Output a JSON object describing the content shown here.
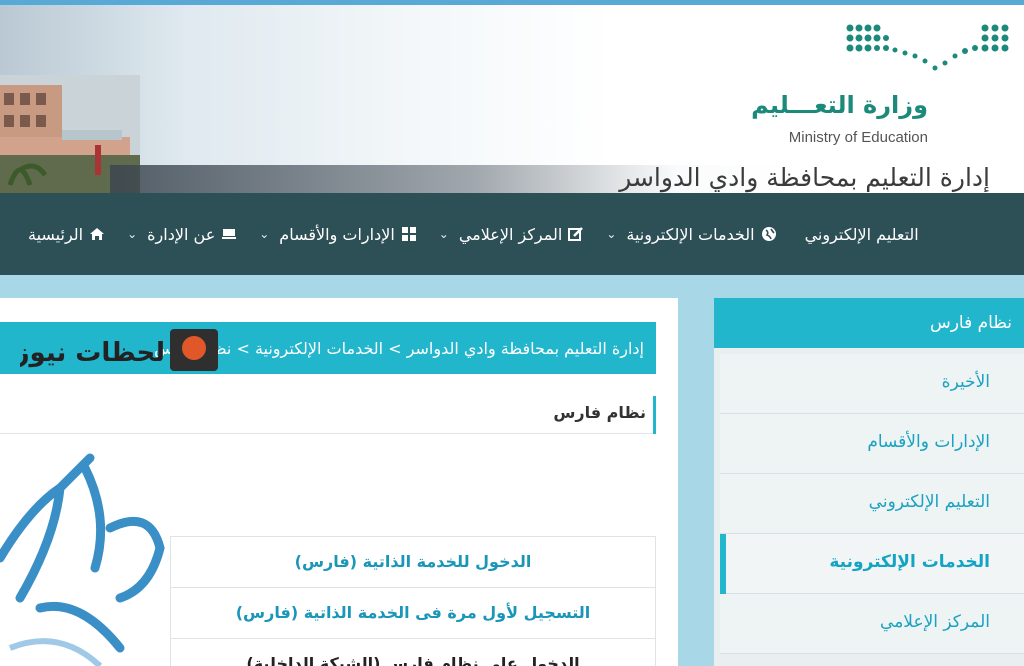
{
  "header": {
    "ministry_ar": "وزارة التعـــليم",
    "ministry_en": "Ministry of Education",
    "directorate": "إدارة التعليم بمحافظة وادي الدواسر"
  },
  "nav": {
    "items": [
      {
        "label": "الرئيسية",
        "icon": "home-icon",
        "dropdown": false
      },
      {
        "label": "عن الإدارة",
        "icon": "desk-icon",
        "dropdown": true
      },
      {
        "label": "الإدارات والأقسام",
        "icon": "grid-icon",
        "dropdown": true
      },
      {
        "label": "المركز الإعلامي",
        "icon": "edit-icon",
        "dropdown": true
      },
      {
        "label": "الخدمات الإلكترونية",
        "icon": "globe-icon",
        "dropdown": true
      },
      {
        "label": "التعليم الإلكتروني",
        "icon": "",
        "dropdown": true
      }
    ]
  },
  "sidebar": {
    "title": "نظام فارس",
    "items": [
      {
        "label": "الأخيرة",
        "active": false
      },
      {
        "label": "الإدارات والأقسام",
        "active": false
      },
      {
        "label": "التعليم الإلكتروني",
        "active": false
      },
      {
        "label": "الخدمات الإلكترونية",
        "active": true
      },
      {
        "label": "المركز الإعلامي",
        "active": false
      }
    ]
  },
  "main": {
    "breadcrumb": "إدارة التعليم بمحافظة وادي الدواسر > الخدمات الإلكترونية > نظام فارس",
    "watermark": "لحظات نيوز",
    "section_title": "نظام فارس",
    "logo_text": "فارس",
    "links": [
      "الدخول للخدمة الذاتية (فارس)",
      "التسجيل لأول مرة فى الخدمة الذاتية (فارس)",
      "الدخول على نظام فارس (الشبكة الداخلية)"
    ]
  },
  "colors": {
    "accent": "#22b6cd",
    "nav_bg": "#2d4f56",
    "link": "#1a96b8",
    "page_bg": "#a8d8e8"
  }
}
